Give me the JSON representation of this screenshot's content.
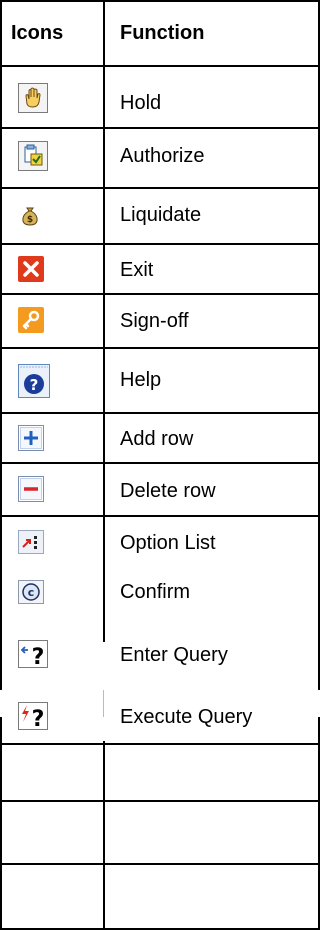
{
  "table": {
    "headers": {
      "icons": "Icons",
      "function": "Function"
    },
    "rows": [
      {
        "icon": "hold-hand-icon",
        "function": "Hold"
      },
      {
        "icon": "authorize-icon",
        "function": "Authorize"
      },
      {
        "icon": "liquidate-moneybag-icon",
        "function": "Liquidate"
      },
      {
        "icon": "exit-x-icon",
        "function": "Exit"
      },
      {
        "icon": "sign-off-key-icon",
        "function": "Sign-off"
      },
      {
        "icon": "help-question-icon",
        "function": "Help"
      },
      {
        "icon": "add-row-plus-icon",
        "function": "Add row"
      },
      {
        "icon": "delete-row-minus-icon",
        "function": "Delete row"
      },
      {
        "icon": "option-list-icon",
        "function": "Option List"
      },
      {
        "icon": "confirm-c-icon",
        "function": "Confirm"
      },
      {
        "icon": "enter-query-icon",
        "function": "Enter Query"
      },
      {
        "icon": "execute-query-icon",
        "function": "Execute Query"
      }
    ]
  },
  "colors": {
    "exit_red": "#e03a1c",
    "signoff_orange": "#f39a1f",
    "help_blue": "#1b3d9a",
    "add_blue": "#1f5fbf",
    "delete_red": "#d8262c",
    "query_red": "#e2231a"
  }
}
